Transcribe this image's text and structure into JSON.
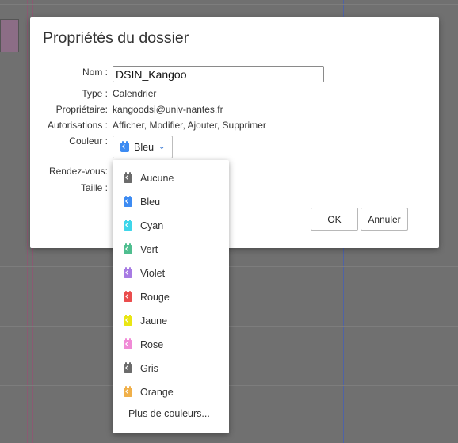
{
  "dialog": {
    "title": "Propriétés du dossier",
    "fields": {
      "name_label": "Nom :",
      "name_value": "DSIN_Kangoo",
      "type_label": "Type :",
      "type_value": "Calendrier",
      "owner_label": "Propriétaire:",
      "owner_value": "kangoodsi@univ-nantes.fr",
      "perms_label": "Autorisations :",
      "perms_value": "Afficher, Modifier, Ajouter, Supprimer",
      "color_label": "Couleur :",
      "color_value": "Bleu",
      "appointments_label": "Rendez-vous:",
      "size_label": "Taille :"
    },
    "ok_label": "OK",
    "cancel_label": "Annuler"
  },
  "color_menu": {
    "items": [
      {
        "label": "Aucune",
        "color": "#6b6b6b",
        "icon": "calendar-icon"
      },
      {
        "label": "Bleu",
        "color": "#3d8bf2",
        "icon": "calendar-icon"
      },
      {
        "label": "Cyan",
        "color": "#3fd6ea",
        "icon": "calendar-icon"
      },
      {
        "label": "Vert",
        "color": "#4fbe8f",
        "icon": "calendar-icon"
      },
      {
        "label": "Violet",
        "color": "#a77be3",
        "icon": "calendar-icon"
      },
      {
        "label": "Rouge",
        "color": "#ea4d4d",
        "icon": "calendar-icon"
      },
      {
        "label": "Jaune",
        "color": "#e9e614",
        "icon": "calendar-icon"
      },
      {
        "label": "Rose",
        "color": "#f08ad6",
        "icon": "calendar-icon"
      },
      {
        "label": "Gris",
        "color": "#6b6b6b",
        "icon": "calendar-icon"
      },
      {
        "label": "Orange",
        "color": "#f0b04a",
        "icon": "calendar-icon"
      }
    ],
    "more_label": "Plus de couleurs..."
  }
}
